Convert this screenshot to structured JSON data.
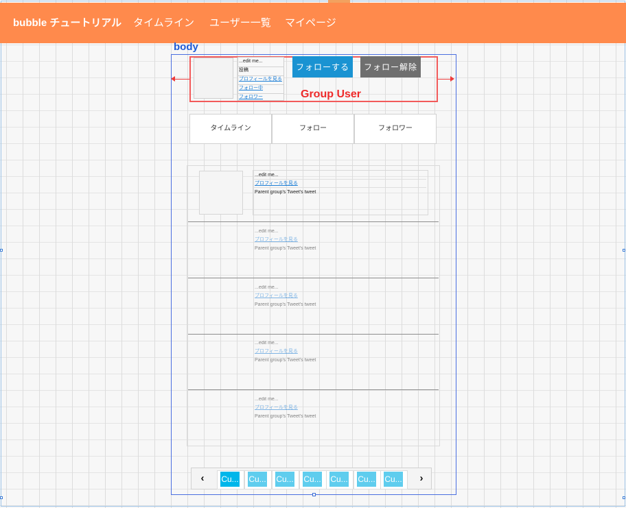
{
  "header": {
    "brand": "bubble チュートリアル",
    "nav": [
      "タイムライン",
      "ユーザー一覧",
      "マイページ"
    ]
  },
  "body_label": "body",
  "group_user": {
    "label": "Group User",
    "info": [
      "...edit me...",
      "投稿",
      "プロフィールを見る",
      "フォロー中",
      "フォロワー"
    ],
    "follow_button": "フォローする",
    "unfollow_button": "フォロー解除"
  },
  "tabs": [
    "タイムライン",
    "フォロー",
    "フォロワー"
  ],
  "tweets": [
    {
      "edit": "...edit me...",
      "profile_link": "プロフィールを見る",
      "tweet": "Parent group's Tweet's tweet"
    },
    {
      "edit": "...edit me...",
      "profile_link": "プロフィールを見る",
      "tweet": "Parent group's Tweet's tweet"
    },
    {
      "edit": "...edit me...",
      "profile_link": "プロフィールを見る",
      "tweet": "Parent group's Tweet's tweet"
    },
    {
      "edit": "...edit me...",
      "profile_link": "プロフィールを見る",
      "tweet": "Parent group's Tweet's tweet"
    },
    {
      "edit": "...edit me...",
      "profile_link": "プロフィールを見る",
      "tweet": "Parent group's Tweet's tweet"
    }
  ],
  "pagination": {
    "prev": "‹",
    "next": "›",
    "pages": [
      "Cu...",
      "Cu...",
      "Cu...",
      "Cu...",
      "Cu...",
      "Cu...",
      "Cu..."
    ]
  },
  "colors": {
    "header": "#ff8a4c",
    "follow": "#1a93d2",
    "unfollow": "#6f6f6f",
    "page_active": "#00b6ea",
    "page_inactive": "#5fcdee",
    "group_outline": "#ee2a2a",
    "body_outline": "#4a6ee0"
  }
}
